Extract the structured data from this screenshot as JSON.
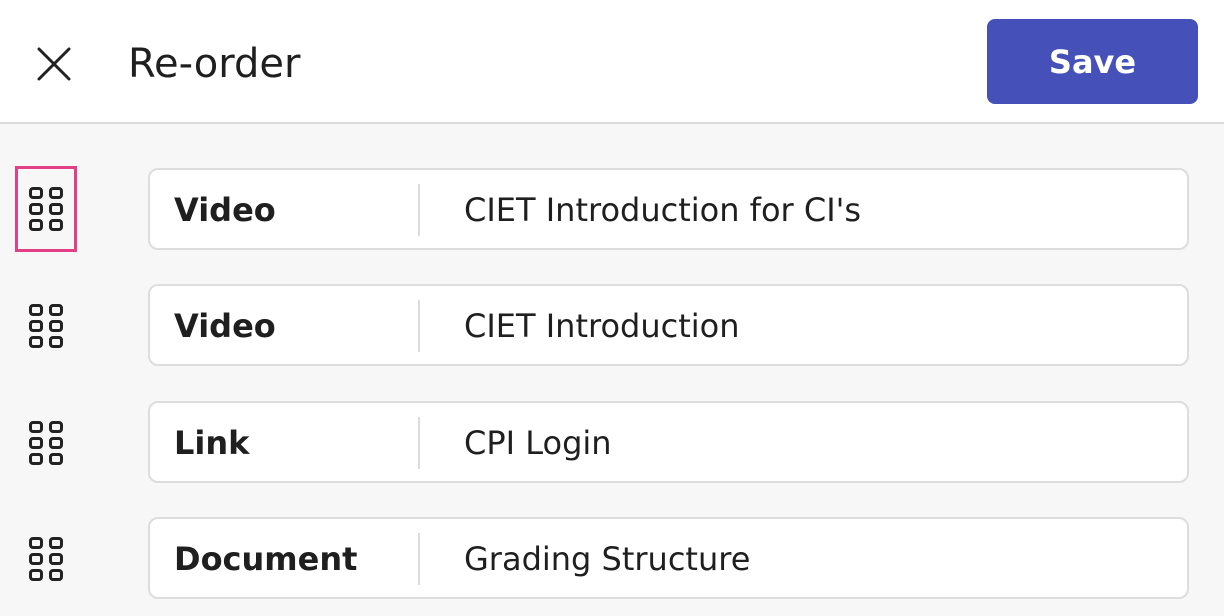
{
  "header": {
    "close_icon": "close-icon",
    "title": "Re-order",
    "save_label": "Save",
    "save_color": "#4551b8"
  },
  "list": {
    "handle_icon": "drag-handle-icon",
    "focus_color": "#e23f86",
    "items": [
      {
        "type": "Video",
        "name": "CIET Introduction for CI's"
      },
      {
        "type": "Video",
        "name": "CIET Introduction"
      },
      {
        "type": "Link",
        "name": "CPI Login"
      },
      {
        "type": "Document",
        "name": "Grading Structure"
      }
    ]
  }
}
